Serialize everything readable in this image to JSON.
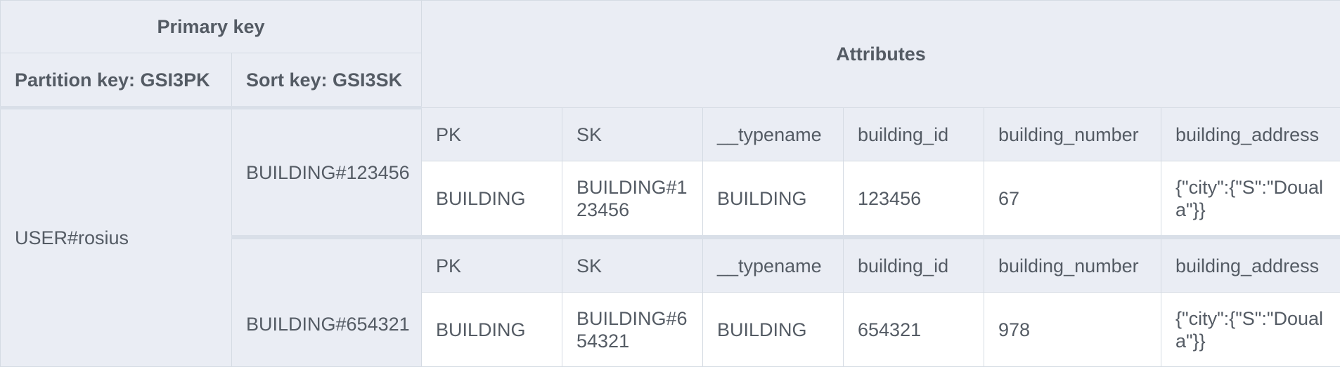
{
  "header": {
    "primary_key": "Primary key",
    "attributes": "Attributes",
    "partition_key": "Partition key: GSI3PK",
    "sort_key": "Sort key: GSI3SK"
  },
  "attribute_columns": [
    "PK",
    "SK",
    "__typename",
    "building_id",
    "building_number",
    "building_address"
  ],
  "partition": {
    "value": "USER#rosius"
  },
  "items": [
    {
      "sort_key": "BUILDING#123456",
      "values": [
        "BUILDING",
        "BUILDING#123456",
        "BUILDING",
        "123456",
        "67",
        "{\"city\":{\"S\":\"Douala\"}}"
      ]
    },
    {
      "sort_key": "BUILDING#654321",
      "values": [
        "BUILDING",
        "BUILDING#654321",
        "BUILDING",
        "654321",
        "978",
        "{\"city\":{\"S\":\"Douala\"}}"
      ]
    }
  ]
}
